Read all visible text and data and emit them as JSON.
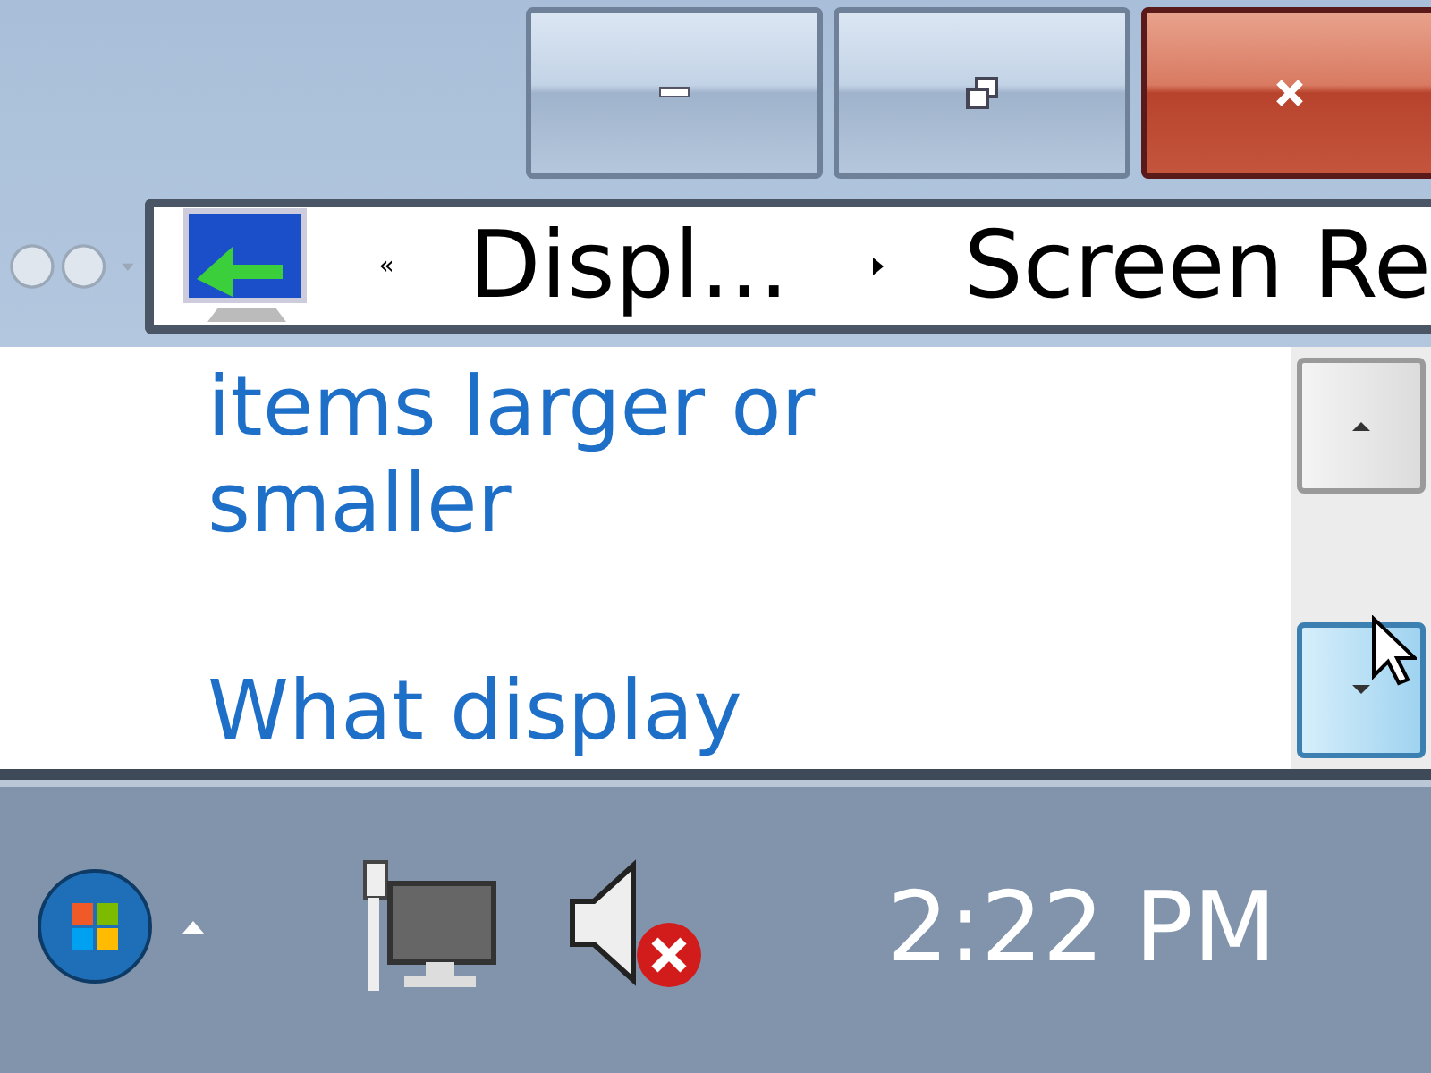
{
  "window": {
    "controls": [
      {
        "kind": "minimize"
      },
      {
        "kind": "restore"
      },
      {
        "kind": "close"
      }
    ]
  },
  "address_bar": {
    "overflow": "«",
    "crumbs": [
      "Displ...",
      "Screen Re"
    ]
  },
  "content": {
    "links": [
      "items larger or",
      "smaller",
      "What display"
    ]
  },
  "taskbar": {
    "clock": "2:22 PM",
    "sound_muted": true
  }
}
